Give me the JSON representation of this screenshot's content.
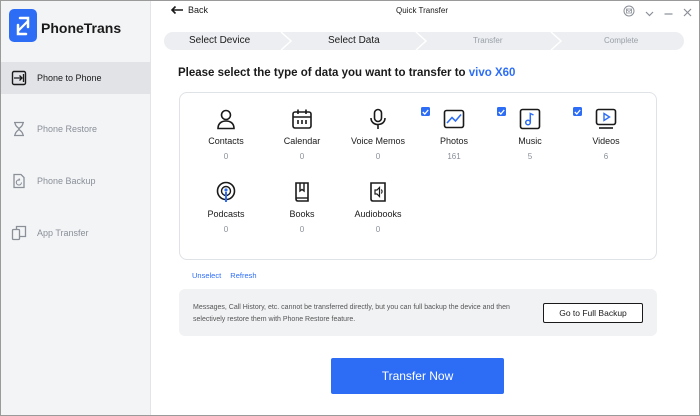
{
  "app": {
    "brand": "PhoneTrans",
    "window_title": "Quick Transfer",
    "accent_color": "#2d6df6"
  },
  "header": {
    "back_label": "Back"
  },
  "sidebar": {
    "items": [
      {
        "label": "Phone to Phone",
        "icon": "phone-to-phone-icon",
        "active": true
      },
      {
        "label": "Phone Restore",
        "icon": "hourglass-icon",
        "active": false
      },
      {
        "label": "Phone Backup",
        "icon": "backup-icon",
        "active": false
      },
      {
        "label": "App Transfer",
        "icon": "app-transfer-icon",
        "active": false
      }
    ]
  },
  "steps": [
    {
      "label": "Select Device",
      "state": "done"
    },
    {
      "label": "Select Data",
      "state": "current"
    },
    {
      "label": "Transfer",
      "state": "pending"
    },
    {
      "label": "Complete",
      "state": "pending"
    }
  ],
  "main": {
    "heading_prefix": "Please select the type of data you want to transfer to",
    "device_name": "vivo X60",
    "categories": [
      {
        "label": "Contacts",
        "count": "0",
        "icon": "contacts-icon",
        "checked": false
      },
      {
        "label": "Calendar",
        "count": "0",
        "icon": "calendar-icon",
        "checked": false
      },
      {
        "label": "Voice Memos",
        "count": "0",
        "icon": "microphone-icon",
        "checked": false
      },
      {
        "label": "Photos",
        "count": "161",
        "icon": "photos-icon",
        "checked": true
      },
      {
        "label": "Music",
        "count": "5",
        "icon": "music-icon",
        "checked": true
      },
      {
        "label": "Videos",
        "count": "6",
        "icon": "videos-icon",
        "checked": true
      },
      {
        "label": "Podcasts",
        "count": "0",
        "icon": "podcasts-icon",
        "checked": false
      },
      {
        "label": "Books",
        "count": "0",
        "icon": "books-icon",
        "checked": false
      },
      {
        "label": "Audiobooks",
        "count": "0",
        "icon": "audiobooks-icon",
        "checked": false
      }
    ],
    "unselect_label": "Unselect",
    "refresh_label": "Refresh",
    "info_text": "Messages, Call History, etc. cannot be transferred directly, but you can full backup the device and then selectively restore them with Phone Restore feature.",
    "full_backup_label": "Go to Full Backup",
    "transfer_label": "Transfer Now"
  }
}
